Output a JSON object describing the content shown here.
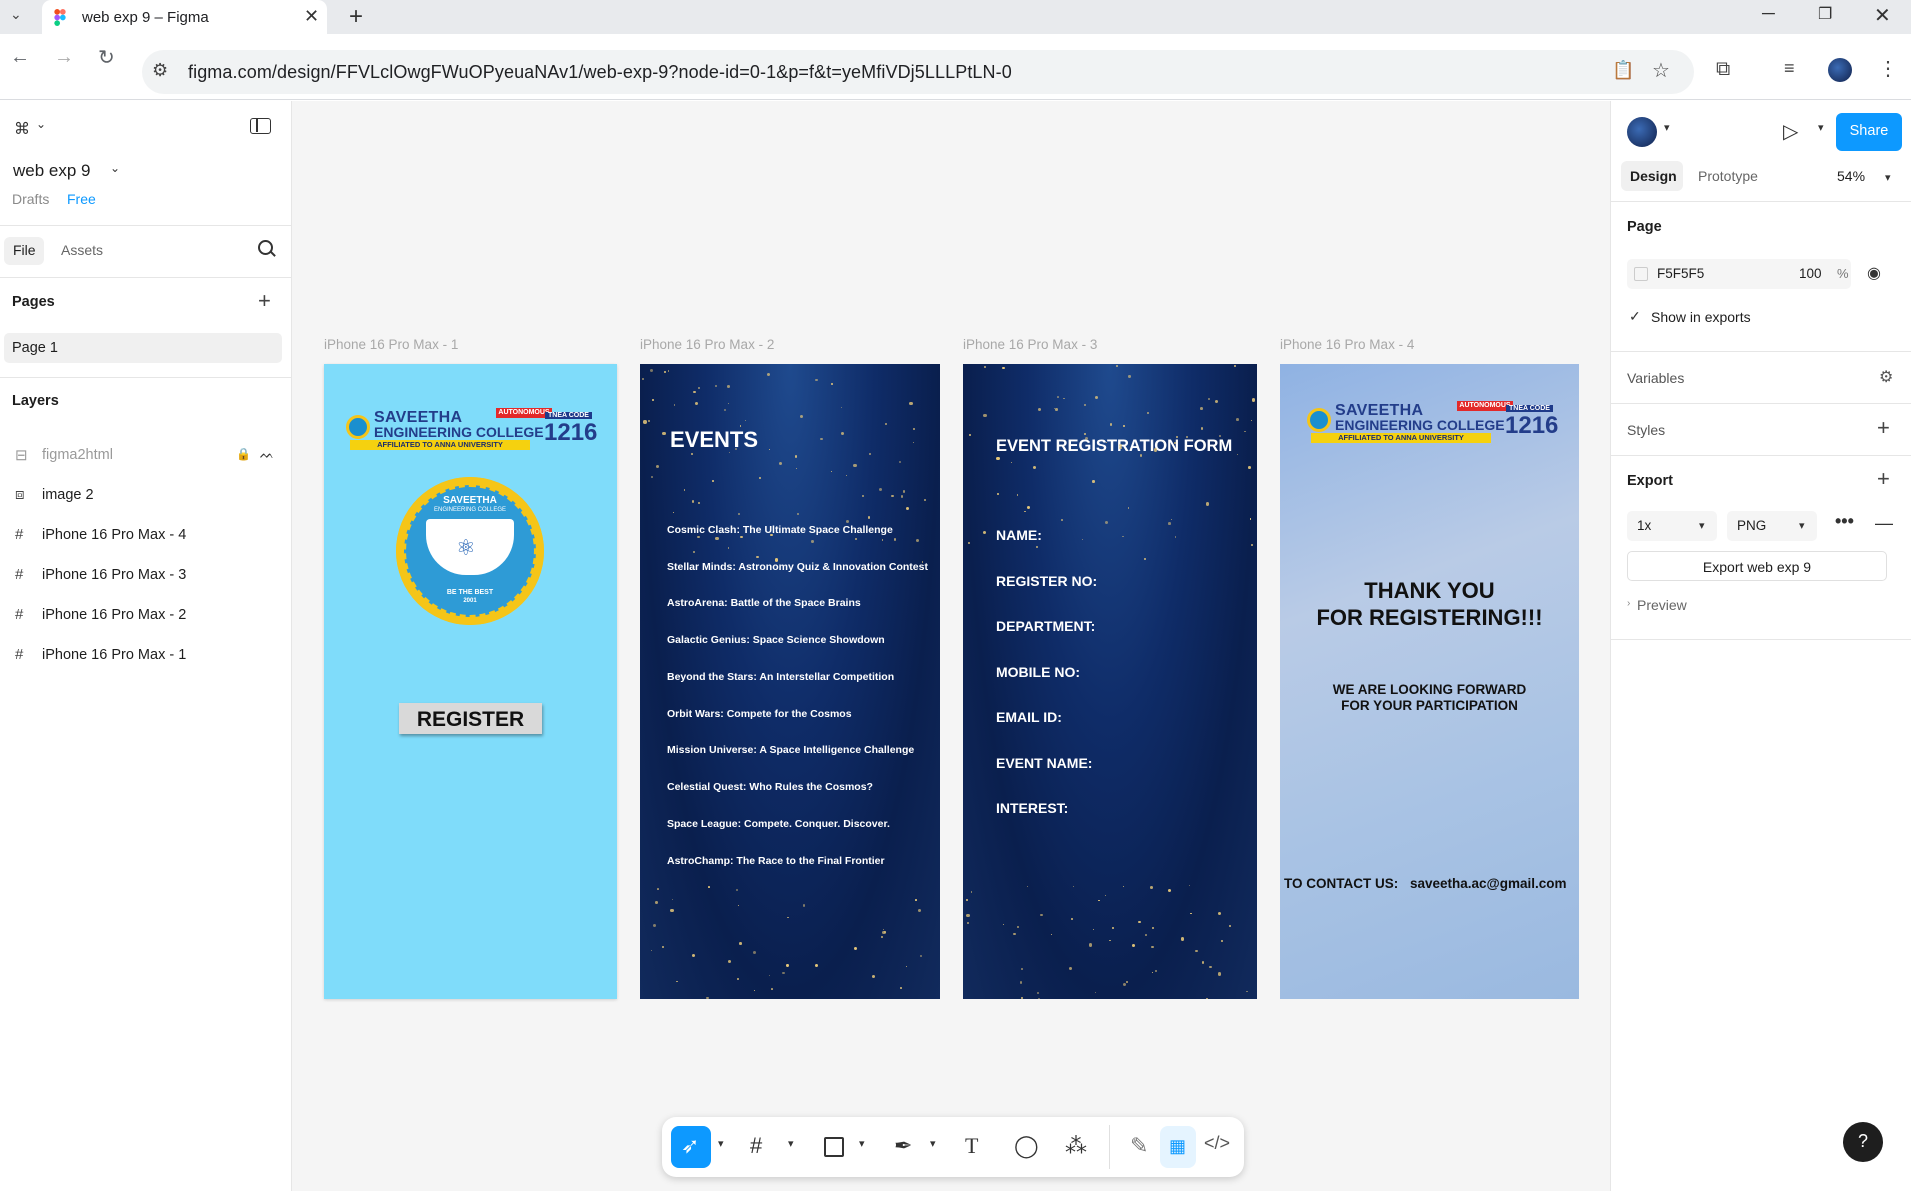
{
  "browser": {
    "tab_title": "web exp 9 – Figma",
    "url": "figma.com/design/FFVLclOwgFWuOPyeuaNAv1/web-exp-9?node-id=0-1&p=f&t=yeMfiVDj5LLLPtLN-0"
  },
  "left_panel": {
    "file_name": "web exp 9",
    "drafts_label": "Drafts",
    "plan_label": "Free",
    "tabs": {
      "file": "File",
      "assets": "Assets"
    },
    "pages_heading": "Pages",
    "pages": [
      {
        "label": "Page 1"
      }
    ],
    "layers_heading": "Layers",
    "layers": [
      {
        "label": "figma2html",
        "icon": "text-frame-icon"
      },
      {
        "label": "image 2",
        "icon": "image-icon"
      },
      {
        "label": "iPhone 16 Pro Max - 4",
        "icon": "frame-icon"
      },
      {
        "label": "iPhone 16 Pro Max - 3",
        "icon": "frame-icon"
      },
      {
        "label": "iPhone 16 Pro Max - 2",
        "icon": "frame-icon"
      },
      {
        "label": "iPhone 16 Pro Max - 1",
        "icon": "frame-icon"
      }
    ]
  },
  "canvas": {
    "frames": [
      {
        "label": "iPhone 16 Pro Max - 1"
      },
      {
        "label": "iPhone 16 Pro Max - 2"
      },
      {
        "label": "iPhone 16 Pro Max - 3"
      },
      {
        "label": "iPhone 16 Pro Max - 4"
      }
    ],
    "logo": {
      "name_line1": "SAVEETHA",
      "name_line2": "ENGINEERING COLLEGE",
      "affiliation": "AFFILIATED TO ANNA UNIVERSITY",
      "autonomous": "AUTONOMOUS",
      "tnea_label": "TNEA CODE",
      "tnea_code": "1216"
    },
    "emblem": {
      "top": "SAVEETHA",
      "sub": "ENGINEERING COLLEGE",
      "motto": "BE THE BEST",
      "year": "2001"
    },
    "frame1": {
      "register_button": "REGISTER"
    },
    "frame2": {
      "title": "EVENTS",
      "events": [
        "Cosmic Clash: The Ultimate Space Challenge",
        "Stellar Minds: Astronomy Quiz & Innovation Contest",
        "AstroArena: Battle of the Space Brains",
        "Galactic Genius: Space Science Showdown",
        "Beyond the Stars: An Interstellar Competition",
        "Orbit Wars: Compete for the Cosmos",
        "Mission Universe: A Space Intelligence Challenge",
        "Celestial Quest: Who Rules the Cosmos?",
        "Space League: Compete. Conquer. Discover.",
        "AstroChamp: The Race to the Final Frontier"
      ]
    },
    "frame3": {
      "title": "EVENT REGISTRATION FORM",
      "fields": [
        "NAME:",
        "REGISTER NO:",
        "DEPARTMENT:",
        "MOBILE NO:",
        "EMAIL ID:",
        "EVENT NAME:",
        "INTEREST:"
      ]
    },
    "frame4": {
      "thanks_line1": "THANK YOU",
      "thanks_line2": "FOR REGISTERING!!!",
      "sub_line1": "WE ARE LOOKING FORWARD",
      "sub_line2": "FOR YOUR PARTICIPATION",
      "contact_label": "TO CONTACT US:",
      "contact_email": "saveetha.ac@gmail.com"
    }
  },
  "right_panel": {
    "share_label": "Share",
    "tabs": {
      "design": "Design",
      "prototype": "Prototype"
    },
    "zoom": "54%",
    "page_heading": "Page",
    "page_color": "F5F5F5",
    "page_opacity": "100",
    "percent_sign": "%",
    "show_in_exports": "Show in exports",
    "variables_heading": "Variables",
    "styles_heading": "Styles",
    "export_heading": "Export",
    "export_scale": "1x",
    "export_format": "PNG",
    "export_button": "Export web exp 9",
    "preview_label": "Preview"
  },
  "colors": {
    "frame1_bg": "#7fdcfa",
    "accent": "#0d99ff",
    "space_bg": "#0f2c68"
  }
}
